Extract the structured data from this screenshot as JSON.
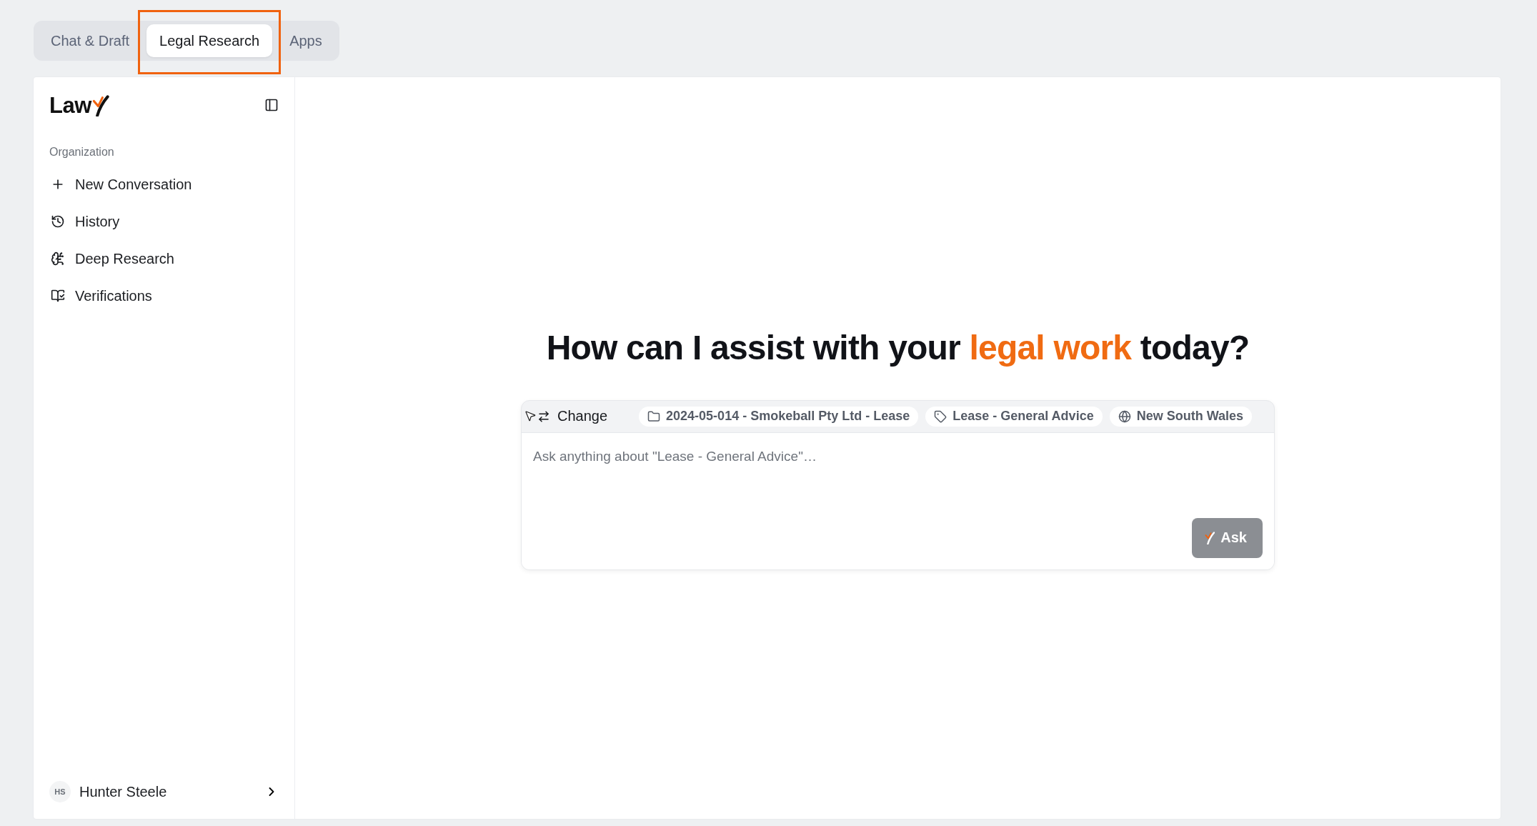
{
  "tabs": [
    {
      "label": "Chat & Draft",
      "selected": false,
      "highlighted": false
    },
    {
      "label": "Legal Research",
      "selected": true,
      "highlighted": true
    },
    {
      "label": "Apps",
      "selected": false,
      "highlighted": false
    }
  ],
  "sidebar": {
    "logo": "Law",
    "section_label": "Organization",
    "items": [
      {
        "kind": "new",
        "label": "New Conversation"
      },
      {
        "kind": "history",
        "label": "History"
      },
      {
        "kind": "deep_research",
        "label": "Deep Research"
      },
      {
        "kind": "verifications",
        "label": "Verifications"
      }
    ],
    "user": {
      "initials": "HS",
      "name": "Hunter Steele"
    }
  },
  "main": {
    "heading": {
      "before": "How can I assist with your ",
      "highlight": "legal work",
      "after": " today?"
    },
    "composer": {
      "change_label": "Change",
      "chips": [
        {
          "kind": "matter",
          "label": "2024-05-014 - Smokeball Pty Ltd - Lease"
        },
        {
          "kind": "topic",
          "label": "Lease - General Advice"
        },
        {
          "kind": "jurisdiction",
          "label": "New South Wales"
        }
      ],
      "placeholder": "Ask anything about \"Lease - General Advice\"…",
      "submit_label": "Ask",
      "submit_disabled": true
    }
  }
}
